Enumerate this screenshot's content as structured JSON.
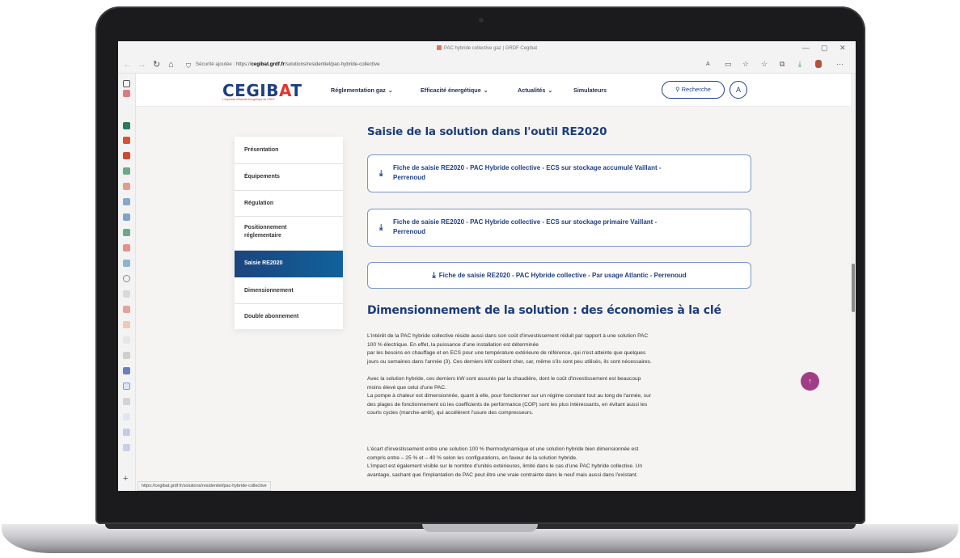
{
  "browser": {
    "tab_title": "PAC hybride collective gaz | GRDF Cegibat",
    "security": "Sécurité ajoutée",
    "url_prefix": "https://",
    "url_host": "cegibat.grdf.fr",
    "url_path": "/solutions/residentiel/pac-hybride-collective",
    "status_url": "https://cegibat.grdf.fr/solutions/residentiel/pac-hybride-collective",
    "window_controls": [
      "—",
      "▢",
      "✕"
    ]
  },
  "site": {
    "logo_main": "CEGIB",
    "logo_accent": "A",
    "logo_end": "T",
    "logo_tagline": "L'expertise efficacité énergétique de GRDF",
    "nav": [
      {
        "label": "Réglementation gaz"
      },
      {
        "label": "Efficacité énergétique"
      },
      {
        "label": "Actualités"
      },
      {
        "label": "Simulateurs"
      }
    ],
    "search_label": "Recherche",
    "brand_colors": {
      "primary": "#1d3f84",
      "accent": "#e3362c",
      "fab": "#a13d87"
    }
  },
  "toc": [
    {
      "label": "Présentation",
      "active": false
    },
    {
      "label": "Équipements",
      "active": false
    },
    {
      "label": "Régulation",
      "active": false
    },
    {
      "label": "Positionnement réglementaire",
      "active": false
    },
    {
      "label": "Saisie RE2020",
      "active": true
    },
    {
      "label": "Dimensionnement",
      "active": false
    },
    {
      "label": "Double abonnement",
      "active": false
    }
  ],
  "main": {
    "section1_title": "Saisie de la solution dans l'outil RE2020",
    "downloads": [
      {
        "line1": "Fiche de saisie RE2020 - PAC Hybride collective - ECS sur stockage accumulé Vaillant -",
        "line2": "Perrenoud"
      },
      {
        "line1": "Fiche de saisie RE2020 - PAC Hybride collective - ECS sur stockage primaire Vaillant -",
        "line2": "Perrenoud"
      },
      {
        "line1": "Fiche de saisie RE2020 - PAC Hybride collective - Par usage Atlantic - Perrenoud",
        "line2": ""
      }
    ],
    "section2_title": "Dimensionnement de la solution : des économies à la clé",
    "paragraphs": [
      [
        "L'intérêt de la PAC hybride collective réside aussi dans son coût d'investissement réduit par rapport à une solution PAC",
        "100 % électrique. En effet, la puissance d'une installation est déterminée",
        "par les besoins en chauffage et en ECS pour une température extérieure de référence, qui n'est atteinte que quelques",
        "jours ou semaines dans l'année (3). Ces derniers kW coûtent cher, car, même s'ils sont peu utilisés, ils sont nécessaires."
      ],
      [
        "Avec la solution hybride, ces derniers kW sont assurés par la chaudière, dont le coût d'investissement est beaucoup",
        "moins élevé que celui d'une PAC.",
        "La pompe à chaleur est dimensionnée, quant à elle, pour fonctionner sur un régime constant tout au long de l'année, sur",
        "des plages de fonctionnement où les coefficients de performance (COP) sont les plus intéressants, en évitant aussi les",
        "courts cycles (marche-arrêt), qui accélèrent l'usure des compresseurs."
      ],
      [
        "L'écart d'investissement entre une solution 100 % thermodynamique et une solution hybride bien dimensionnée est",
        "compris entre – 25 % et – 40 % selon les configurations, en faveur de la solution hybride.",
        "L'impact est également visible sur le nombre d'unités extérieures, limité dans le cas d'une PAC hybride collective. Un",
        "avantage, sachant que l'implantation de PAC peut être une vraie contrainte dans le neuf mais aussi dans l'existant."
      ]
    ]
  },
  "icons": {
    "download": "download-icon",
    "scroll_top": "arrow-up-icon",
    "search": "search-icon",
    "user": "user-icon"
  }
}
